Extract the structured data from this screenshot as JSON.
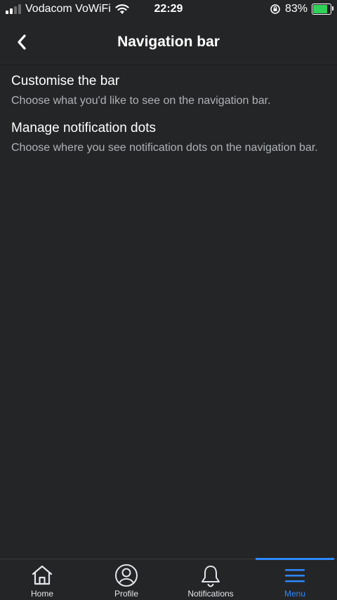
{
  "status_bar": {
    "carrier": "Vodacom VoWiFi",
    "time": "22:29",
    "battery_percent": "83%",
    "battery_level": 0.83,
    "signal_bars_filled": 2,
    "signal_bars_total": 4
  },
  "header": {
    "title": "Navigation bar",
    "back_icon": "chevron-left-icon"
  },
  "items": [
    {
      "title": "Customise the bar",
      "description": "Choose what you'd like to see on the navigation bar."
    },
    {
      "title": "Manage notification dots",
      "description": "Choose where you see notification dots on the navigation bar."
    }
  ],
  "bottom_nav": {
    "tabs": [
      {
        "label": "Home",
        "icon": "home-icon",
        "active": false
      },
      {
        "label": "Profile",
        "icon": "profile-icon",
        "active": false
      },
      {
        "label": "Notifications",
        "icon": "bell-icon",
        "active": false
      },
      {
        "label": "Menu",
        "icon": "menu-icon",
        "active": true
      }
    ]
  },
  "colors": {
    "background": "#242526",
    "accent": "#2d88ff",
    "text_primary": "#ffffff",
    "text_secondary": "#b0b3b8"
  }
}
